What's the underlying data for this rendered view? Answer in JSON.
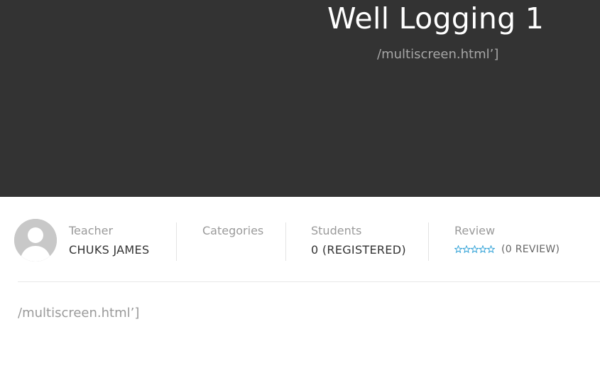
{
  "hero": {
    "title": "Well Logging 1",
    "subtitle": "/multiscreen.html’]"
  },
  "meta": {
    "teacher_label": "Teacher",
    "teacher_name": "CHUKS JAMES",
    "categories_label": "Categories",
    "categories_value": "",
    "students_label": "Students",
    "students_value": "0 (REGISTERED)",
    "review_label": "Review",
    "review_rating": 0,
    "review_max": 5,
    "review_count": "(0 REVIEW)"
  },
  "content": {
    "text": "/multiscreen.html’]"
  },
  "colors": {
    "hero_bg": "#333333",
    "star_outline": "#2a9fd6"
  },
  "icons": [
    "avatar-placeholder-icon",
    "star-outline-icon"
  ]
}
